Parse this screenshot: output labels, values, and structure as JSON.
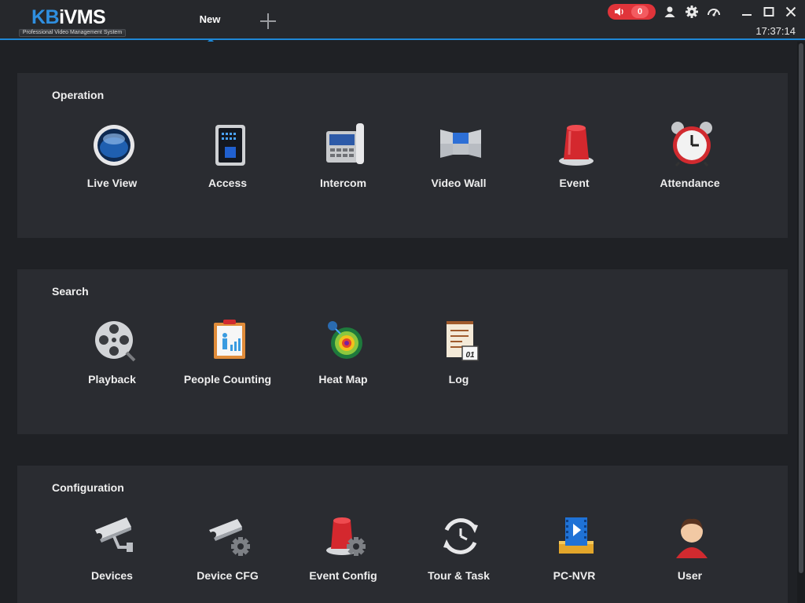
{
  "app": {
    "logo_main": "KB",
    "logo_rest": "iVMS",
    "logo_subtitle": "Professional Video Management System",
    "tab_new": "New",
    "alarm_count": "0",
    "clock": "17:37:14",
    "accent_color": "#1e88d6",
    "alarm_color": "#e0343a"
  },
  "sections": {
    "operation": {
      "title": "Operation",
      "items": [
        {
          "label": "Live View",
          "icon": "live-view-icon"
        },
        {
          "label": "Access",
          "icon": "access-icon"
        },
        {
          "label": "Intercom",
          "icon": "intercom-icon"
        },
        {
          "label": "Video Wall",
          "icon": "video-wall-icon"
        },
        {
          "label": "Event",
          "icon": "event-icon"
        },
        {
          "label": "Attendance",
          "icon": "alarm-clock-icon"
        }
      ]
    },
    "search": {
      "title": "Search",
      "items": [
        {
          "label": "Playback",
          "icon": "film-reel-icon"
        },
        {
          "label": "People Counting",
          "icon": "people-counting-icon"
        },
        {
          "label": "Heat Map",
          "icon": "heat-map-icon"
        },
        {
          "label": "Log",
          "icon": "log-icon"
        }
      ]
    },
    "configuration": {
      "title": "Configuration",
      "items": [
        {
          "label": "Devices",
          "icon": "camera-icon"
        },
        {
          "label": "Device CFG",
          "icon": "camera-gear-icon"
        },
        {
          "label": "Event Config",
          "icon": "event-gear-icon"
        },
        {
          "label": "Tour & Task",
          "icon": "tour-task-icon"
        },
        {
          "label": "PC-NVR",
          "icon": "pc-nvr-icon"
        },
        {
          "label": "User",
          "icon": "user-icon"
        }
      ]
    }
  }
}
